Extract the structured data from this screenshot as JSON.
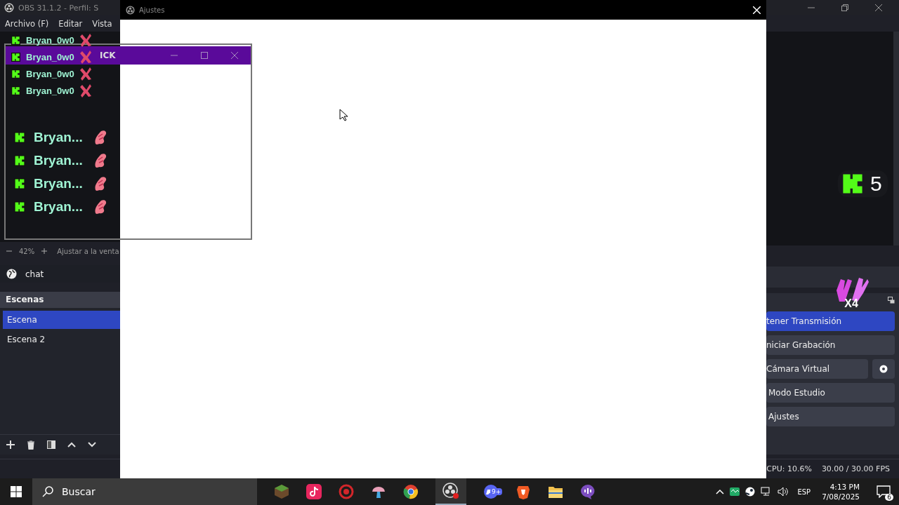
{
  "obs_window": {
    "title": "OBS 31.1.2 - Perfil: S",
    "menu": [
      "Archivo (F)",
      "Editar",
      "Vista"
    ]
  },
  "preview": {
    "chat_small": [
      {
        "name": "Bryan_0w0"
      },
      {
        "name": "Bryan_0w0"
      },
      {
        "name": "Bryan_0w0"
      },
      {
        "name": "Bryan_0w0"
      }
    ],
    "chat_large": [
      {
        "name": "Bryan..."
      },
      {
        "name": "Bryan..."
      },
      {
        "name": "Bryan..."
      },
      {
        "name": "Bryan..."
      }
    ],
    "zoom_percent": "42%",
    "fit_label": "Ajustar a la venta"
  },
  "chat_window": {
    "title": "ICK"
  },
  "sources": [
    {
      "name": "chat"
    }
  ],
  "scenes": {
    "title": "Escenas",
    "items": [
      {
        "name": "Escena",
        "selected": true
      },
      {
        "name": "Escena 2",
        "selected": false
      }
    ]
  },
  "kick_badge": {
    "count": "5"
  },
  "reaction": {
    "multiplier": "X4"
  },
  "controls": [
    {
      "label": "tener Transmisión",
      "active": true,
      "settings": false
    },
    {
      "label": "niciar Grabación",
      "active": false,
      "settings": false
    },
    {
      "label": "Cámara Virtual",
      "active": false,
      "settings": true
    },
    {
      "label": "Modo Estudio",
      "active": false,
      "settings": false
    },
    {
      "label": "Ajustes",
      "active": false,
      "settings": false
    }
  ],
  "status_bar": {
    "cpu": "CPU: 10.6%",
    "fps": "30.00 / 30.00 FPS"
  },
  "settings_window": {
    "title": "Ajustes"
  },
  "taskbar": {
    "search_placeholder": "Buscar",
    "chat_app_badge": "9+",
    "language": "ESP",
    "time": "4:13 PM",
    "date": "7/08/2025",
    "notifications": "6"
  }
}
